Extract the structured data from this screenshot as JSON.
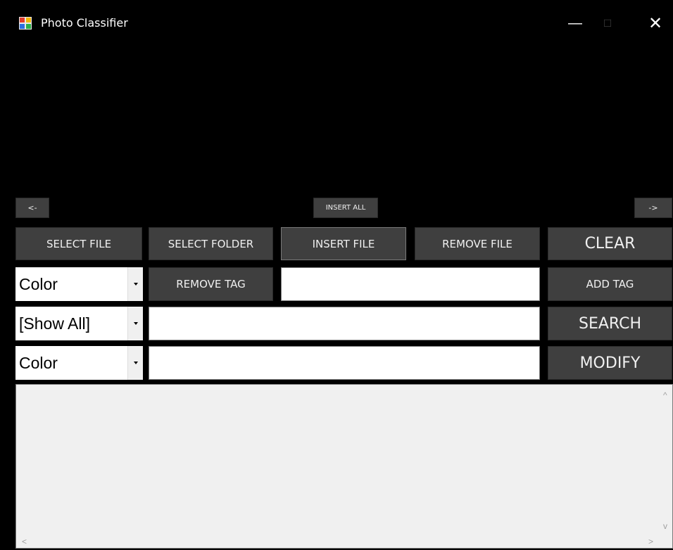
{
  "window": {
    "title": "Photo Classifier",
    "controls": {
      "minimize": "—",
      "maximize": "☐",
      "close": "✕"
    }
  },
  "nav": {
    "prev_label": "<-",
    "insert_all_label": "INSERT ALL",
    "next_label": "->"
  },
  "toolbar": {
    "select_file": "SELECT FILE",
    "select_folder": "SELECT FOLDER",
    "insert_file": "INSERT FILE",
    "remove_file": "REMOVE FILE",
    "clear": "CLEAR"
  },
  "tag_row": {
    "category_value": "Color",
    "remove_tag": "REMOVE TAG",
    "tag_input_value": "",
    "add_tag": "ADD TAG"
  },
  "search_row": {
    "filter_value": "[Show All]",
    "search_input_value": "",
    "search": "SEARCH"
  },
  "modify_row": {
    "category_value": "Color",
    "modify_input_value": "",
    "modify": "MODIFY"
  },
  "scroll": {
    "up": "^",
    "down": "v",
    "left": "<",
    "right": ">"
  }
}
